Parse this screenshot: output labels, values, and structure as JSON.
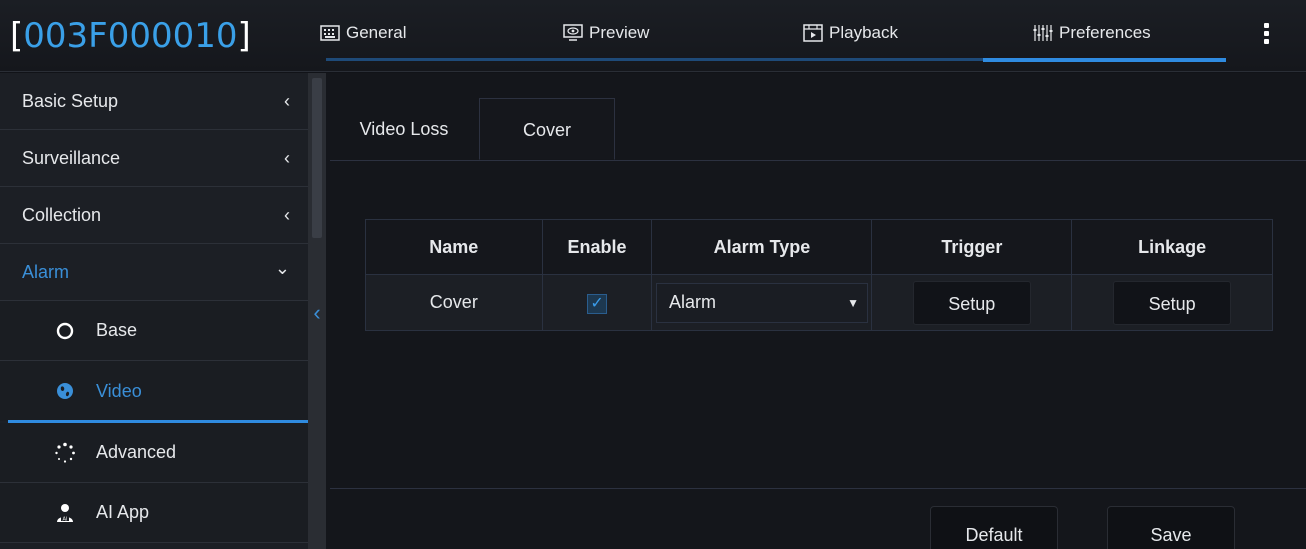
{
  "header": {
    "device_id": "003F000010",
    "tabs": [
      {
        "label": "General",
        "icon": "keyboard-icon"
      },
      {
        "label": "Preview",
        "icon": "monitor-eye-icon"
      },
      {
        "label": "Playback",
        "icon": "film-icon"
      },
      {
        "label": "Preferences",
        "icon": "sliders-icon"
      }
    ],
    "active_tab": "Preferences"
  },
  "sidebar": {
    "items": [
      {
        "label": "Basic Setup",
        "chevron": "‹"
      },
      {
        "label": "Surveillance",
        "chevron": "‹"
      },
      {
        "label": "Collection",
        "chevron": "‹"
      },
      {
        "label": "Alarm",
        "chevron": "⌄"
      }
    ],
    "subitems": [
      {
        "label": "Base",
        "icon": "circle-icon"
      },
      {
        "label": "Video",
        "icon": "globe-icon"
      },
      {
        "label": "Advanced",
        "icon": "dots-spinner-icon"
      },
      {
        "label": "AI App",
        "icon": "ai-person-icon"
      }
    ],
    "active_subitem": "Video"
  },
  "subtabs": {
    "video_loss": "Video Loss",
    "cover": "Cover",
    "active": "Cover"
  },
  "table": {
    "headers": [
      "Name",
      "Enable",
      "Alarm Type",
      "Trigger",
      "Linkage"
    ],
    "rows": [
      {
        "name": "Cover",
        "enabled": true,
        "alarm_type": "Alarm",
        "trigger": "Setup",
        "linkage": "Setup"
      }
    ]
  },
  "footer": {
    "default_label": "Default",
    "save_label": "Save"
  },
  "colors": {
    "accent": "#2f8be0",
    "active_text": "#3a8fd8",
    "device_id": "#3aa0e8"
  }
}
